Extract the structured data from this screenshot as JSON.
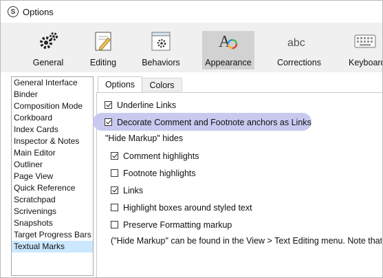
{
  "window": {
    "title": "Options",
    "app_icon_letter": "S"
  },
  "toolbar": {
    "tabs": [
      {
        "label": "General",
        "icon": "gears-icon"
      },
      {
        "label": "Editing",
        "icon": "pencil-page-icon"
      },
      {
        "label": "Behaviors",
        "icon": "window-gear-icon"
      },
      {
        "label": "Appearance",
        "icon": "appearance-icon",
        "active": true
      },
      {
        "label": "Corrections",
        "icon": "abc-icon"
      },
      {
        "label": "Keyboard",
        "icon": "keyboard-icon"
      }
    ],
    "abc_text": "abc",
    "appearance_glyph": "A"
  },
  "sidebar": {
    "items": [
      "General Interface",
      "Binder",
      "Composition Mode",
      "Corkboard",
      "Index Cards",
      "Inspector & Notes",
      "Main Editor",
      "Outliner",
      "Page View",
      "Quick Reference",
      "Scratchpad",
      "Scrivenings",
      "Snapshots",
      "Target Progress Bars",
      "Textual Marks"
    ],
    "selected": "Textual Marks"
  },
  "panel": {
    "tabs": [
      "Options",
      "Colors"
    ],
    "active_tab": "Options",
    "options": {
      "underline_links": {
        "label": "Underline Links",
        "checked": true
      },
      "decorate_anchors": {
        "label": "Decorate Comment and Footnote anchors as Links",
        "checked": true
      },
      "hide_markup_heading": "\"Hide Markup\" hides",
      "comment_highlights": {
        "label": "Comment highlights",
        "checked": true
      },
      "footnote_highlights": {
        "label": "Footnote highlights",
        "checked": false
      },
      "links": {
        "label": "Links",
        "checked": true
      },
      "highlight_boxes": {
        "label": "Highlight boxes around styled text",
        "checked": false
      },
      "preserve_formatting": {
        "label": "Preserve Formatting markup",
        "checked": false
      },
      "note": "(\"Hide Markup\" can be found in the View > Text Editing menu. Note that it"
    }
  },
  "colors": {
    "highlight": "#c9c9f0",
    "selected_item": "#cce8ff",
    "toolbar_bg": "#f0f0f0",
    "active_tab_bg": "#d2d2d2"
  }
}
